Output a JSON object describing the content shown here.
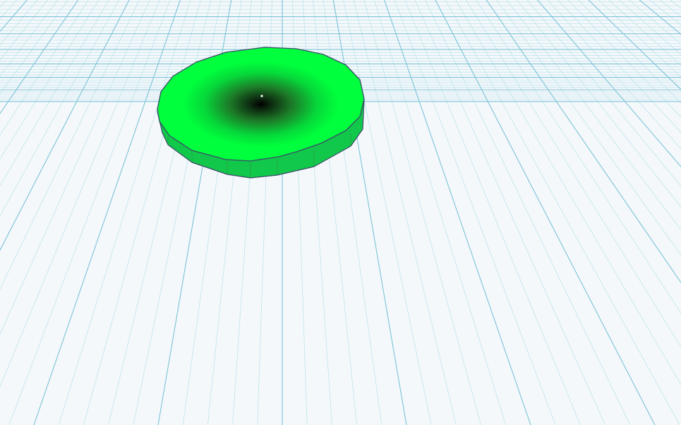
{
  "workplane": {
    "background_color": "#f4f8fa",
    "minor_grid_color": "#bfe3ee",
    "major_grid_color": "#7cc3d9"
  },
  "shape": {
    "kind": "cylinder",
    "top_face_color": "#00ff3c",
    "side_color": "#12c84a",
    "outline_color": "#3a4a6a"
  }
}
